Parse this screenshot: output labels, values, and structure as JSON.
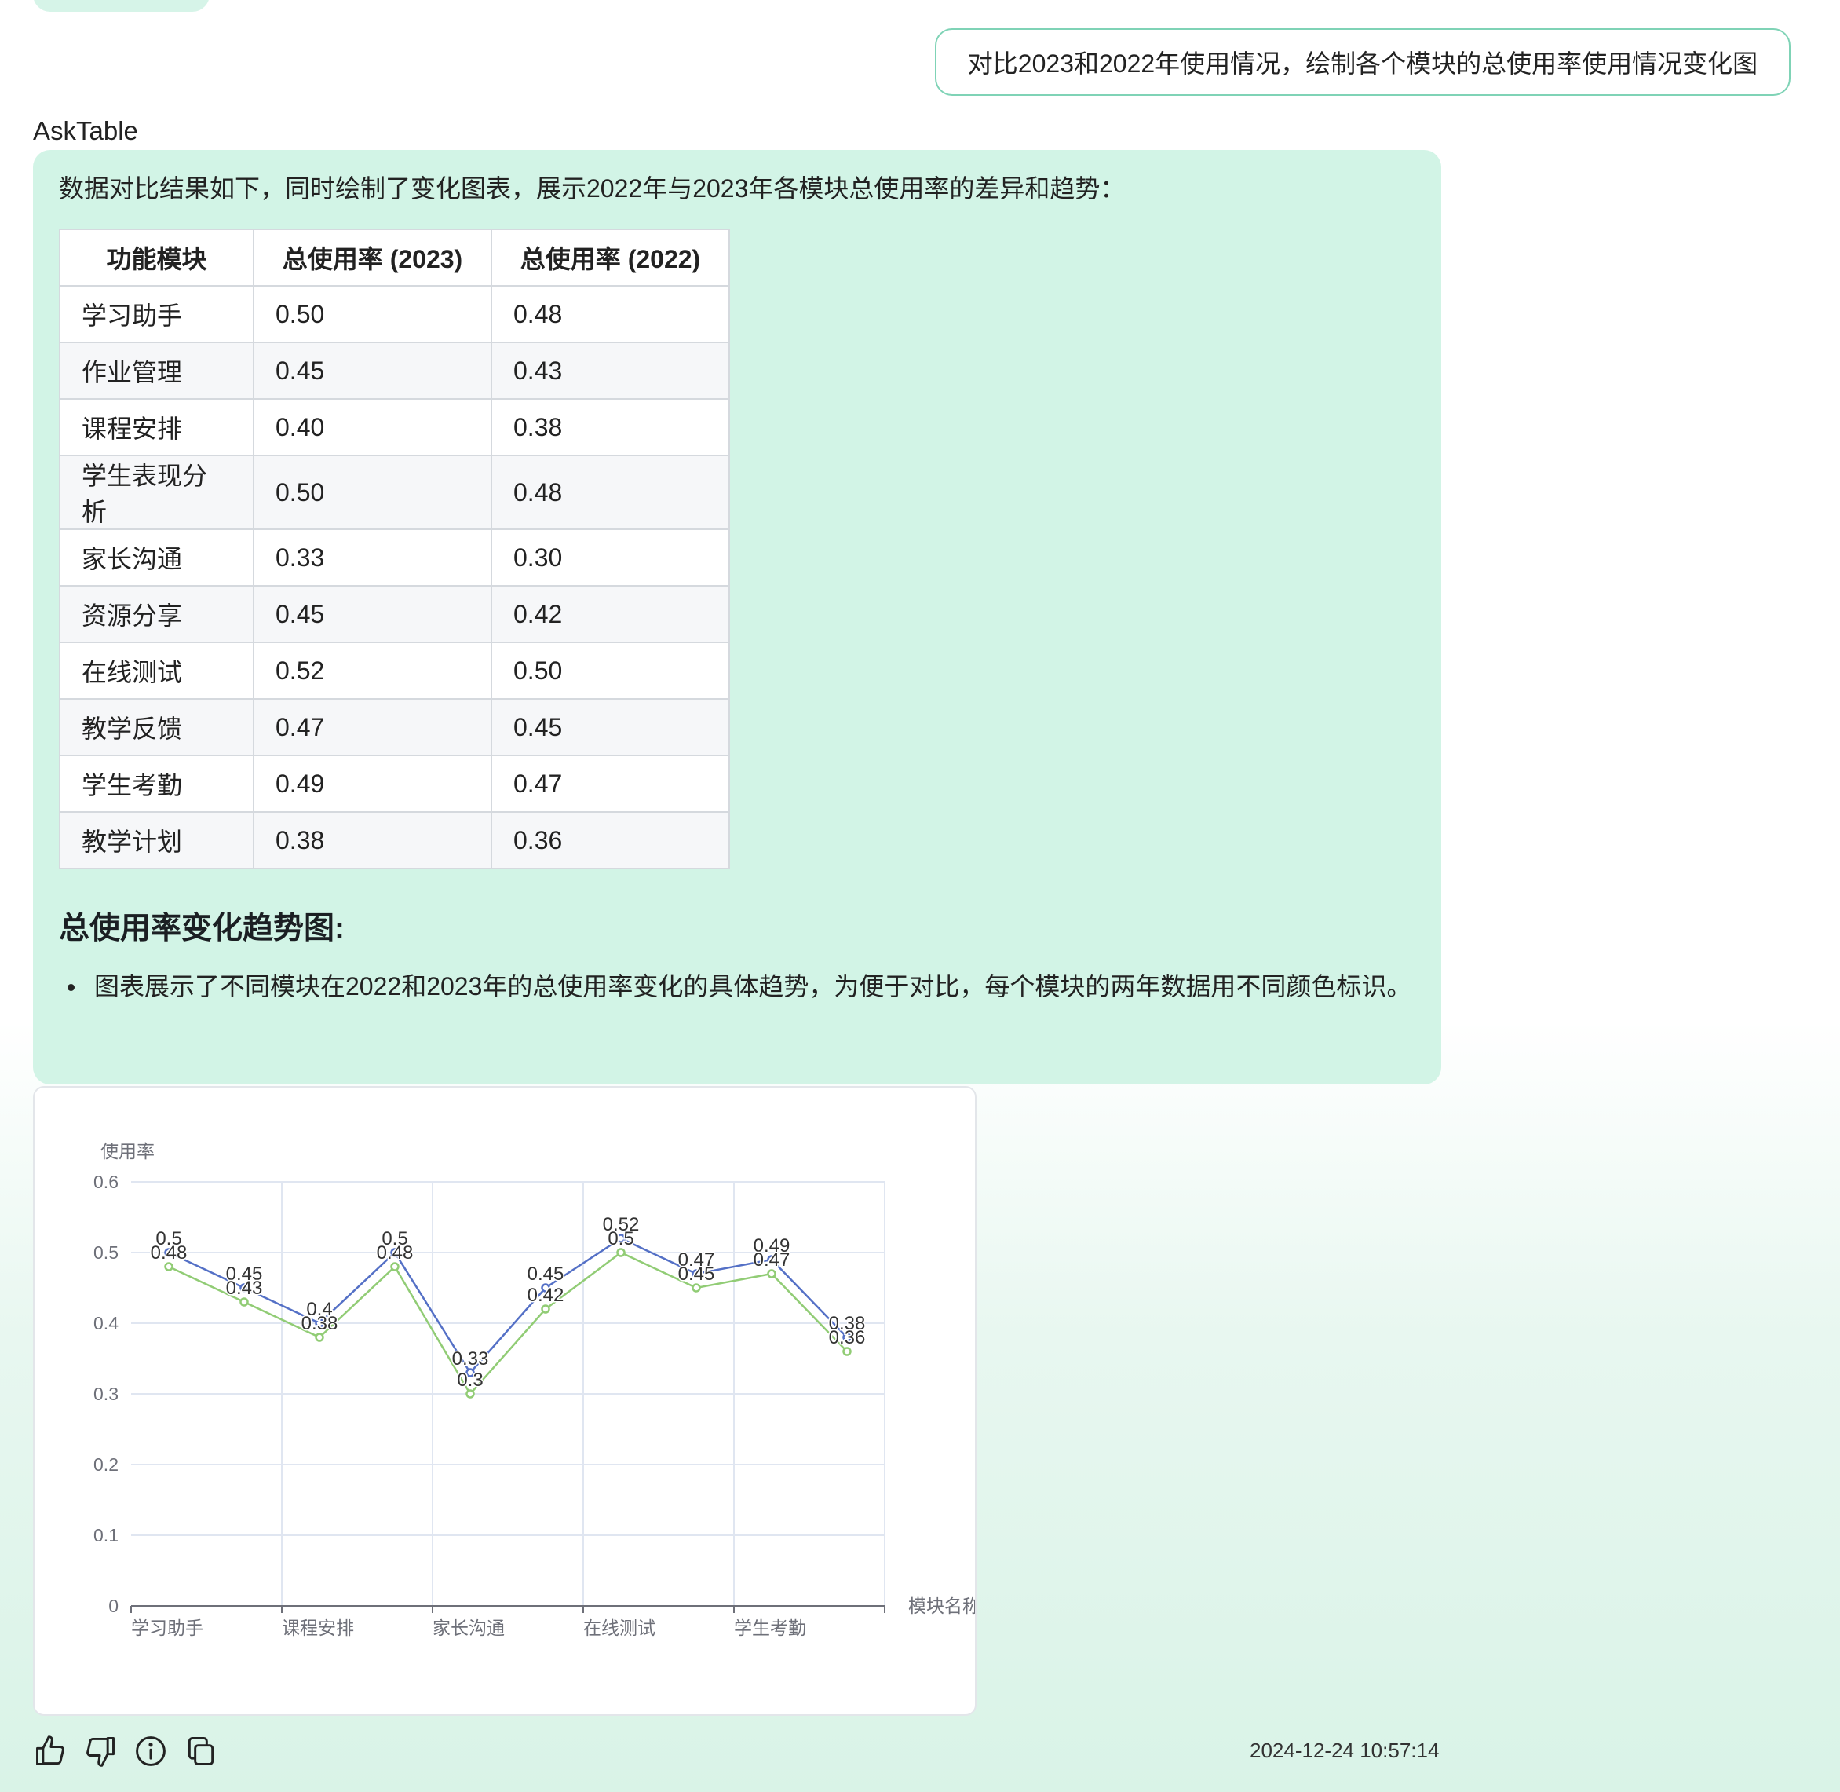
{
  "user_message": "对比2023和2022年使用情况，绘制各个模块的总使用率使用情况变化图",
  "bot_name": "AskTable",
  "answer": {
    "intro": "数据对比结果如下，同时绘制了变化图表，展示2022年与2023年各模块总使用率的差异和趋势：",
    "table": {
      "headers": [
        "功能模块",
        "总使用率 (2023)",
        "总使用率 (2022)"
      ],
      "rows": [
        [
          "学习助手",
          "0.50",
          "0.48"
        ],
        [
          "作业管理",
          "0.45",
          "0.43"
        ],
        [
          "课程安排",
          "0.40",
          "0.38"
        ],
        [
          "学生表现分析",
          "0.50",
          "0.48"
        ],
        [
          "家长沟通",
          "0.33",
          "0.30"
        ],
        [
          "资源分享",
          "0.45",
          "0.42"
        ],
        [
          "在线测试",
          "0.52",
          "0.50"
        ],
        [
          "教学反馈",
          "0.47",
          "0.45"
        ],
        [
          "学生考勤",
          "0.49",
          "0.47"
        ],
        [
          "教学计划",
          "0.38",
          "0.36"
        ]
      ]
    },
    "heading": "总使用率变化趋势图:",
    "bullet": "图表展示了不同模块在2022和2023年的总使用率变化的具体趋势，为便于对比，每个模块的两年数据用不同颜色标识。"
  },
  "chart_data": {
    "type": "line",
    "ylabel": "使用率",
    "xlabel": "模块名称",
    "ylim": [
      0,
      0.6
    ],
    "yticks": [
      "0",
      "0.1",
      "0.2",
      "0.3",
      "0.4",
      "0.5",
      "0.6"
    ],
    "categories": [
      "学习助手",
      "作业管理",
      "课程安排",
      "学生表现分析",
      "家长沟通",
      "资源分享",
      "在线测试",
      "教学反馈",
      "学生考勤",
      "教学计划"
    ],
    "x_tick_labels": [
      "学习助手",
      "课程安排",
      "家长沟通",
      "在线测试",
      "学生考勤"
    ],
    "grid": true,
    "series": [
      {
        "values": [
          0.5,
          0.45,
          0.4,
          0.5,
          0.33,
          0.45,
          0.52,
          0.47,
          0.49,
          0.38
        ],
        "labels": [
          "0.5",
          "0.45",
          "0.4",
          "0.5",
          "0.33",
          "0.45",
          "0.52",
          "0.47",
          "0.49",
          "0.38"
        ],
        "color": "#5470c6"
      },
      {
        "values": [
          0.48,
          0.43,
          0.38,
          0.48,
          0.3,
          0.42,
          0.5,
          0.45,
          0.47,
          0.36
        ],
        "labels": [
          "0.48",
          "0.43",
          "0.38",
          "0.48",
          "0.3",
          "0.42",
          "0.5",
          "0.45",
          "0.47",
          "0.36"
        ],
        "color": "#91cc75"
      }
    ]
  },
  "actions": {
    "icons": [
      "thumbs-up-icon",
      "thumbs-down-icon",
      "info-icon",
      "copy-icon"
    ]
  },
  "timestamp": "2024-12-24 10:57:14"
}
